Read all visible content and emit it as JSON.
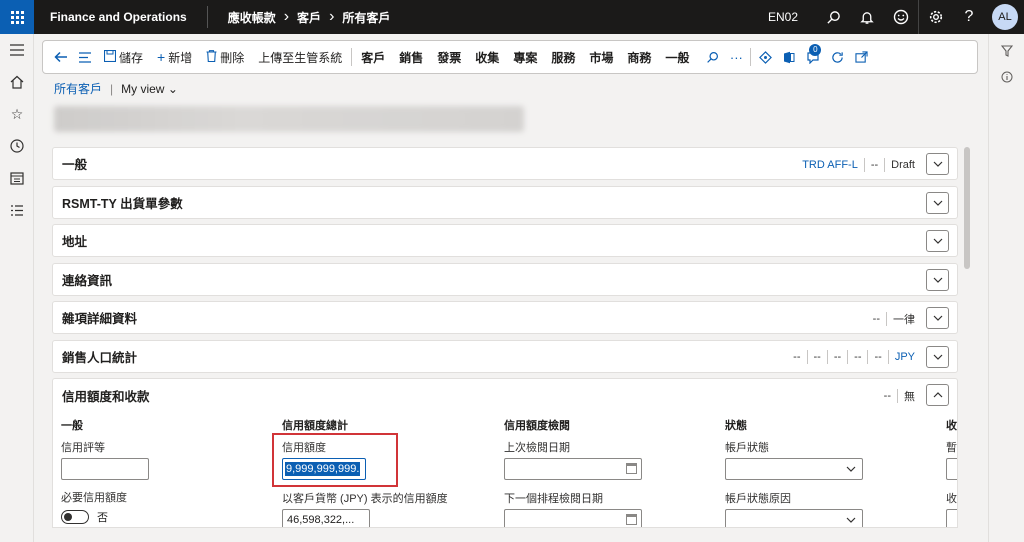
{
  "topbar": {
    "app_title": "Finance and Operations",
    "breadcrumb": [
      "應收帳款",
      "客戶",
      "所有客戶"
    ],
    "company": "EN02",
    "avatar_initials": "AL"
  },
  "actionpane": {
    "save": "儲存",
    "new": "新增",
    "delete": "刪除",
    "upload": "上傳至生管系統",
    "menus": [
      "客戶",
      "銷售",
      "發票",
      "收集",
      "專案",
      "服務",
      "市場",
      "商務",
      "一般"
    ],
    "attach_count": "0"
  },
  "page": {
    "list_link": "所有客戶",
    "view": "My view"
  },
  "fasttabs": [
    {
      "title": "一般",
      "summary": [
        "TRD AFF-L",
        "--",
        "Draft"
      ],
      "link_index": 0
    },
    {
      "title": "RSMT-TY 出貨單參數",
      "summary": []
    },
    {
      "title": "地址",
      "summary": []
    },
    {
      "title": "連絡資訊",
      "summary": []
    },
    {
      "title": "雜項詳細資料",
      "summary": [
        "--",
        "一律"
      ]
    },
    {
      "title": "銷售人口統計",
      "summary": [
        "--",
        "--",
        "--",
        "--",
        "--",
        "JPY"
      ],
      "link_index": 5
    },
    {
      "title": "信用額度和收款",
      "summary": [
        "--",
        "無"
      ]
    }
  ],
  "credit": {
    "general_title": "一般",
    "rating_label": "信用評等",
    "mandatory_label": "必要信用額度",
    "mandatory_value": "否",
    "summary_title": "信用額度總計",
    "limit_label": "信用額度",
    "limit_value": "9,999,999,999.",
    "currency_label": "以客戶貨幣 (JPY) 表示的信用額度",
    "currency_value": "46,598,322,...",
    "review_title": "信用額度檢閱",
    "last_review_label": "上次檢閱日期",
    "next_review_label": "下一個排程檢閱日期",
    "status_title": "狀態",
    "account_status_label": "帳戶狀態",
    "status_reason_label": "帳戶狀態原因",
    "collect_title": "收",
    "collect_field1": "暫",
    "collect_field2": "收"
  },
  "colors": {
    "brand": "#0b5fb3",
    "highlight": "#d13438",
    "topbar": "#1b1a19"
  }
}
